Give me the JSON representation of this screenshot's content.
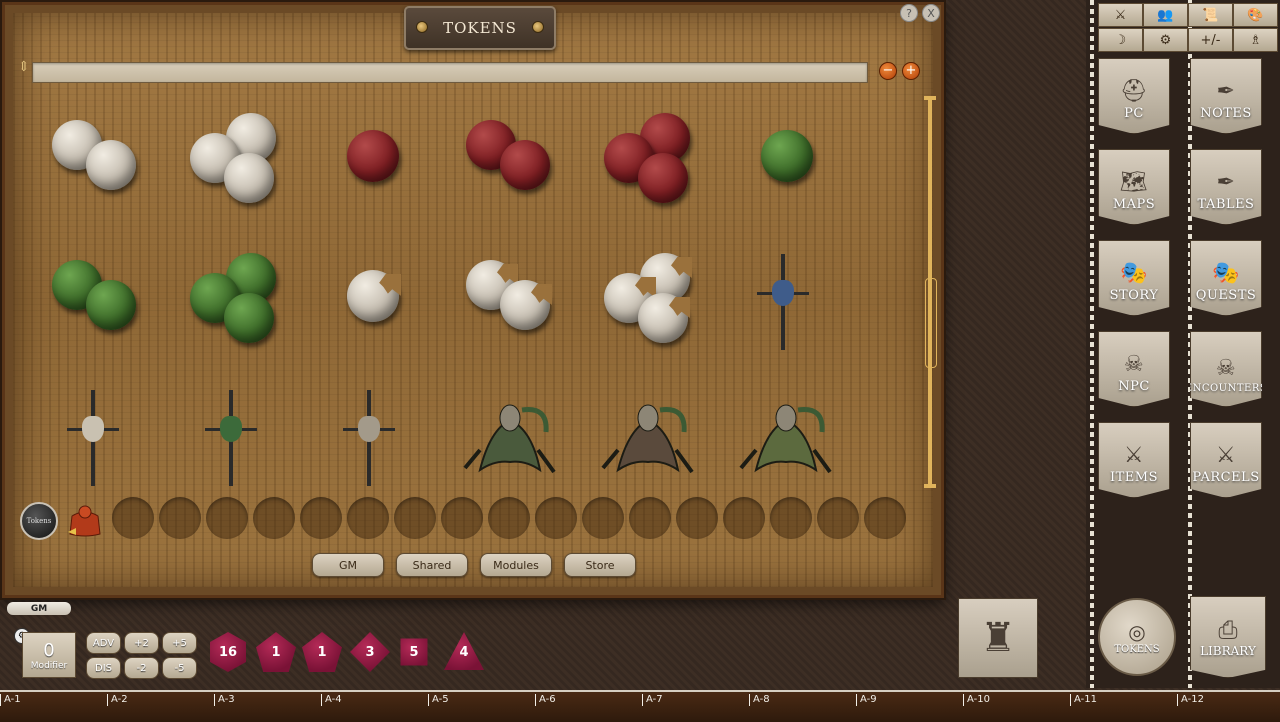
{
  "window": {
    "title": "TOKENS",
    "help_label": "?",
    "close_label": "X"
  },
  "filter": {
    "placeholder": "",
    "zoom_out": "−",
    "zoom_in": "+"
  },
  "tokens": [
    {
      "id": "white-2",
      "kind": "orbs",
      "color": "white",
      "count": 2
    },
    {
      "id": "white-3",
      "kind": "orbs",
      "color": "white",
      "count": 3
    },
    {
      "id": "red-1",
      "kind": "orbs",
      "color": "red",
      "count": 1
    },
    {
      "id": "red-2",
      "kind": "orbs",
      "color": "red",
      "count": 2
    },
    {
      "id": "red-3",
      "kind": "orbs",
      "color": "red",
      "count": 3
    },
    {
      "id": "green-1",
      "kind": "orbs",
      "color": "green",
      "count": 1
    },
    {
      "id": "green-2",
      "kind": "orbs",
      "color": "green",
      "count": 2
    },
    {
      "id": "green-3",
      "kind": "orbs",
      "color": "green",
      "count": 3
    },
    {
      "id": "cracked-1",
      "kind": "orbs",
      "color": "white",
      "count": 1,
      "cracked": true
    },
    {
      "id": "cracked-2",
      "kind": "orbs",
      "color": "white",
      "count": 2,
      "cracked": true
    },
    {
      "id": "cracked-3",
      "kind": "orbs",
      "color": "white",
      "count": 3,
      "cracked": true
    },
    {
      "id": "totem-blue",
      "kind": "totem",
      "head": "#3f5c8a"
    },
    {
      "id": "totem-skull",
      "kind": "totem",
      "head": "#c9c1b1"
    },
    {
      "id": "totem-green",
      "kind": "totem",
      "head": "#3c6a3a"
    },
    {
      "id": "totem-bone",
      "kind": "totem",
      "head": "#a39a8a"
    },
    {
      "id": "beast-1",
      "kind": "beast",
      "tint": "#4a5a3c"
    },
    {
      "id": "beast-2",
      "kind": "beast",
      "tint": "#5a4a3c"
    },
    {
      "id": "beast-3",
      "kind": "beast",
      "tint": "#5c6a3e"
    }
  ],
  "token_bar": {
    "tokens_label": "Tokens",
    "slot_count": 17
  },
  "sources": [
    "GM",
    "Shared",
    "Modules",
    "Store"
  ],
  "toolbar": [
    "⚔",
    "👥",
    "📜",
    "🎨",
    "☽",
    "⚙",
    "+/-",
    "♗"
  ],
  "sidebar_buttons": [
    {
      "id": "pc",
      "label": "PC",
      "glyph": "⛑"
    },
    {
      "id": "notes",
      "label": "NOTES",
      "glyph": "✒"
    },
    {
      "id": "maps",
      "label": "MAPS",
      "glyph": "🗺"
    },
    {
      "id": "tables",
      "label": "TABLES",
      "glyph": "✒"
    },
    {
      "id": "story",
      "label": "STORY",
      "glyph": "🎭"
    },
    {
      "id": "quests",
      "label": "QUESTS",
      "glyph": "🎭"
    },
    {
      "id": "npc",
      "label": "NPC",
      "glyph": "☠"
    },
    {
      "id": "encounters",
      "label": "ENCOUNTERS",
      "glyph": "☠"
    },
    {
      "id": "items",
      "label": "ITEMS",
      "glyph": "⚔"
    },
    {
      "id": "parcels",
      "label": "PARCELS",
      "glyph": "⚔"
    }
  ],
  "bottom": {
    "gm_tab": "GM",
    "modifier_value": "0",
    "modifier_label": "Modifier",
    "modifier_buttons": [
      "ADV",
      "+2",
      "+5",
      "DIS",
      "-2",
      "-5"
    ],
    "dice": [
      "16",
      "1",
      "1",
      "3",
      "5",
      "4"
    ],
    "tokens_button": "TOKENS",
    "library_button": "LIBRARY"
  },
  "ruler": [
    "A-1",
    "A-2",
    "A-3",
    "A-4",
    "A-5",
    "A-6",
    "A-7",
    "A-8",
    "A-9",
    "A-10",
    "A-11",
    "A-12"
  ],
  "colors": {
    "accent_orange": "#e06420",
    "dice": "#9c1c46",
    "wood": "#9a713c"
  }
}
